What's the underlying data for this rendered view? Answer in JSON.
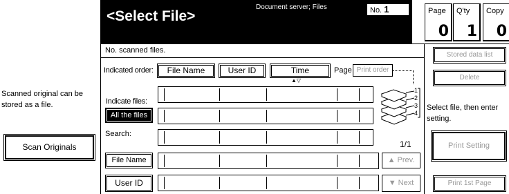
{
  "header": {
    "title": "<Select File>",
    "subtitle": "Document server; Files",
    "no_label": "No.",
    "no_value": "1"
  },
  "counters": [
    {
      "label": "Page",
      "value": "0"
    },
    {
      "label": "Q'ty",
      "value": "1"
    },
    {
      "label": "Copy",
      "value": "0"
    }
  ],
  "status": "No. scanned files.",
  "left_panel": {
    "message_line1": "Scanned original can be",
    "message_line2": "stored as a file.",
    "scan_button": "Scan Originals"
  },
  "order": {
    "label": "Indicated order:",
    "file_name": "File Name",
    "user_id": "User ID",
    "time": "Time",
    "page": "Page",
    "print_order": "Print order"
  },
  "indicate": {
    "label": "Indicate files:",
    "all_files": "All the files"
  },
  "search": {
    "label": "Search:",
    "file_name": "File Name",
    "user_id": "User ID"
  },
  "pagination": {
    "page_indicator": "1/1",
    "prev": "Prev.",
    "next": "Next"
  },
  "stack_numbers": [
    "1",
    "2",
    "3",
    "4"
  ],
  "right_panel": {
    "stored_data_list": "Stored data list",
    "delete": "Delete",
    "hint_line1": "Select file, then enter",
    "hint_line2": "setting.",
    "print_setting": "Print Setting",
    "print_1st_page": "Print 1st Page"
  }
}
